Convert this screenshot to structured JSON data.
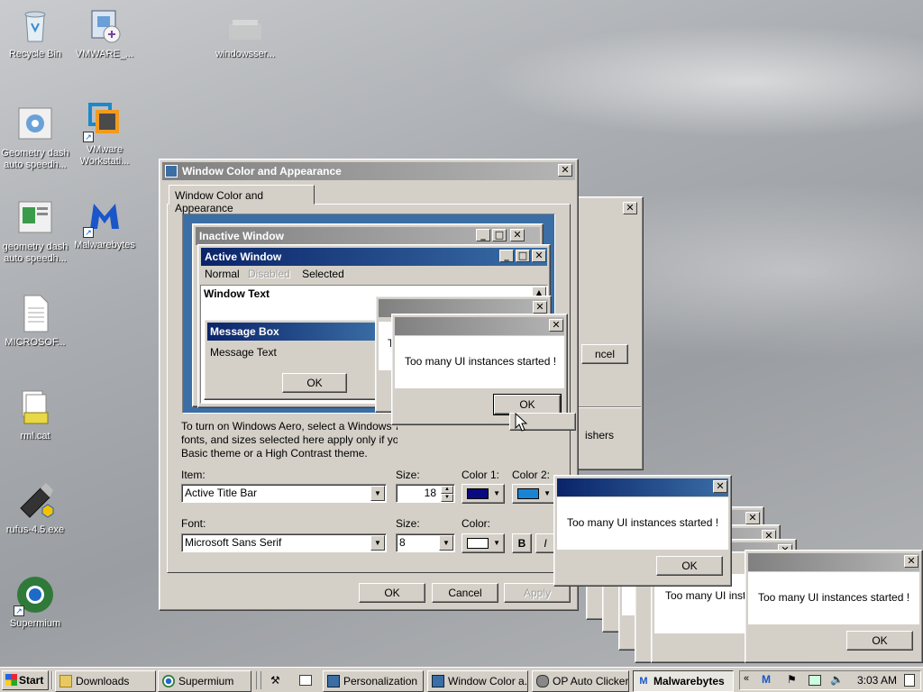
{
  "desktop": {
    "icons": [
      {
        "label": "Recycle Bin",
        "icon": "recycle-bin-icon"
      },
      {
        "label": "VMWARE_...",
        "icon": "installer-icon"
      },
      {
        "label": "windowsser...",
        "icon": "folder-icon"
      },
      {
        "label": "Geometry dash auto speedh...",
        "icon": "app-icon"
      },
      {
        "label": "VMware Workstati...",
        "icon": "vmware-icon"
      },
      {
        "label": "geometry dash auto speedh...",
        "icon": "app-icon"
      },
      {
        "label": "Malwarebytes",
        "icon": "malwarebytes-icon"
      },
      {
        "label": "MICROSOF...",
        "icon": "document-icon"
      },
      {
        "label": "rml.cat",
        "icon": "catalog-icon"
      },
      {
        "label": "rufus-4.5.exe",
        "icon": "usb-drive-icon"
      },
      {
        "label": "Supermium",
        "icon": "browser-icon"
      }
    ]
  },
  "appearance_dialog": {
    "title": "Window Color and Appearance",
    "tab": "Window Color and Appearance",
    "preview": {
      "inactive_title": "Inactive Window",
      "active_title": "Active Window",
      "menu": [
        "Normal",
        "Disabled",
        "Selected"
      ],
      "window_text": "Window Text",
      "message_box_title": "Message Box",
      "message_text": "Message Text",
      "ok": "OK"
    },
    "description_lines": [
      "To turn on Windows Aero, select a Windows 7 th",
      "fonts, and sizes selected here apply only if you h",
      "Basic theme or a High Contrast theme."
    ],
    "item_label": "Item:",
    "item_value": "Active Title Bar",
    "size_label": "Size:",
    "size_value": "18",
    "color1_label": "Color 1:",
    "color2_label": "Color 2:",
    "color1": "#0a0a80",
    "color2": "#1a84d4",
    "font_label": "Font:",
    "font_value": "Microsoft Sans Serif",
    "font_size_label": "Size:",
    "font_size_value": "8",
    "font_color_label": "Color:",
    "bold": "B",
    "italic": "I",
    "ok": "OK",
    "cancel": "Cancel",
    "apply": "Apply"
  },
  "background_window": {
    "cancel_partial": "ncel",
    "publishers_partial": "ishers"
  },
  "error_message": "Too many UI instances started !",
  "ok_label": "OK",
  "partial_text": "Too many UI instar",
  "partial_t": "T",
  "taskbar": {
    "start": "Start",
    "buttons": [
      "Downloads",
      "Supermium",
      "Personalization",
      "Window Color a...",
      "OP Auto Clicker...",
      "Malwarebytes"
    ],
    "time": "3:03 AM"
  }
}
